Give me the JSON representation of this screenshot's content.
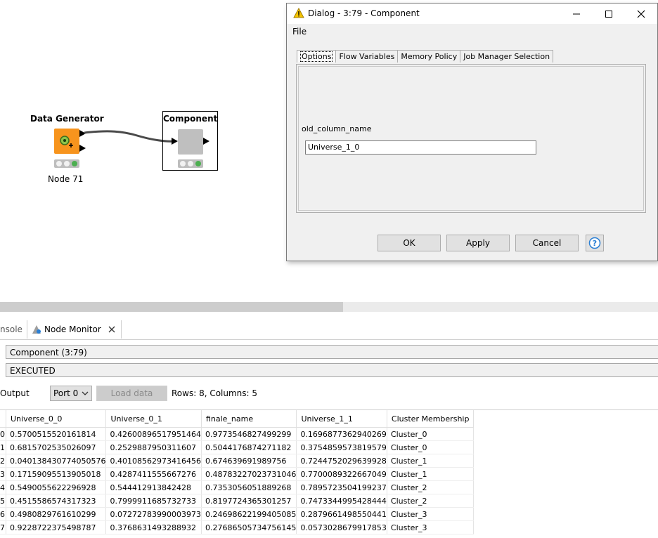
{
  "canvas": {
    "data_generator": {
      "title": "Data Generator",
      "label": "Node 71"
    },
    "component": {
      "title": "Component"
    }
  },
  "dialog": {
    "title": "Dialog - 3:79 - Component",
    "menu": [
      "File"
    ],
    "tabs": [
      "Options",
      "Flow Variables",
      "Memory Policy",
      "Job Manager Selection"
    ],
    "field": {
      "label": "old_column_name",
      "value": "Universe_1_0"
    },
    "buttons": {
      "ok": "OK",
      "apply": "Apply",
      "cancel": "Cancel"
    }
  },
  "bottom_panel": {
    "tabs": {
      "console": "nsole",
      "monitor": "Node Monitor"
    },
    "node_name": "Component  (3:79)",
    "status": "EXECUTED",
    "output_label": "Output",
    "port_select": "Port 0",
    "load_button": "Load data",
    "rows_info": "Rows: 8, Columns: 5",
    "table": {
      "columns": [
        "Universe_0_0",
        "Universe_0_1",
        "finale_name",
        "Universe_1_1",
        "Cluster Membership"
      ],
      "rows": [
        [
          "0",
          "0.5700515520161814",
          "0.42600896517951464",
          "0.9773546827499299",
          "0.1696877362940269",
          "Cluster_0"
        ],
        [
          "1",
          "0.6815702535026097",
          "0.2529887950311607",
          "0.5044176874271182",
          "0.375485957381957​9",
          "Cluster_0"
        ],
        [
          "2",
          "0.040138430774050576",
          "0.40108562973416456",
          "0.674639691989756",
          "0.7244752029639928",
          "Cluster_1"
        ],
        [
          "3",
          "0.17159095513905018",
          "0.4287411555667276",
          "0.48783227023731046",
          "0.7700089322667049",
          "Cluster_1"
        ],
        [
          "4",
          "0.5490055622296928",
          "0.544412913842428",
          "0.7353056051889268",
          "0.7895723504199237",
          "Cluster_2"
        ],
        [
          "5",
          "0.4515586574317323",
          "0.7999911685732733",
          "0.8197724365301257",
          "0.7473344995428444",
          "Cluster_2"
        ],
        [
          "6",
          "0.4980829761610299",
          "0.07272783990003973",
          "0.24698622199405085",
          "0.2879661498550441",
          "Cluster_3"
        ],
        [
          "7",
          "0.9228722375498787",
          "0.3768631493288932",
          "0.27686505734756145",
          "0.0573028679917853",
          "Cluster_3"
        ]
      ]
    }
  },
  "colors": {
    "node_orange": "#f7941d",
    "light_green": "#4caf50",
    "warning_yellow": "#f5c400",
    "help_blue": "#2a7fd4"
  }
}
